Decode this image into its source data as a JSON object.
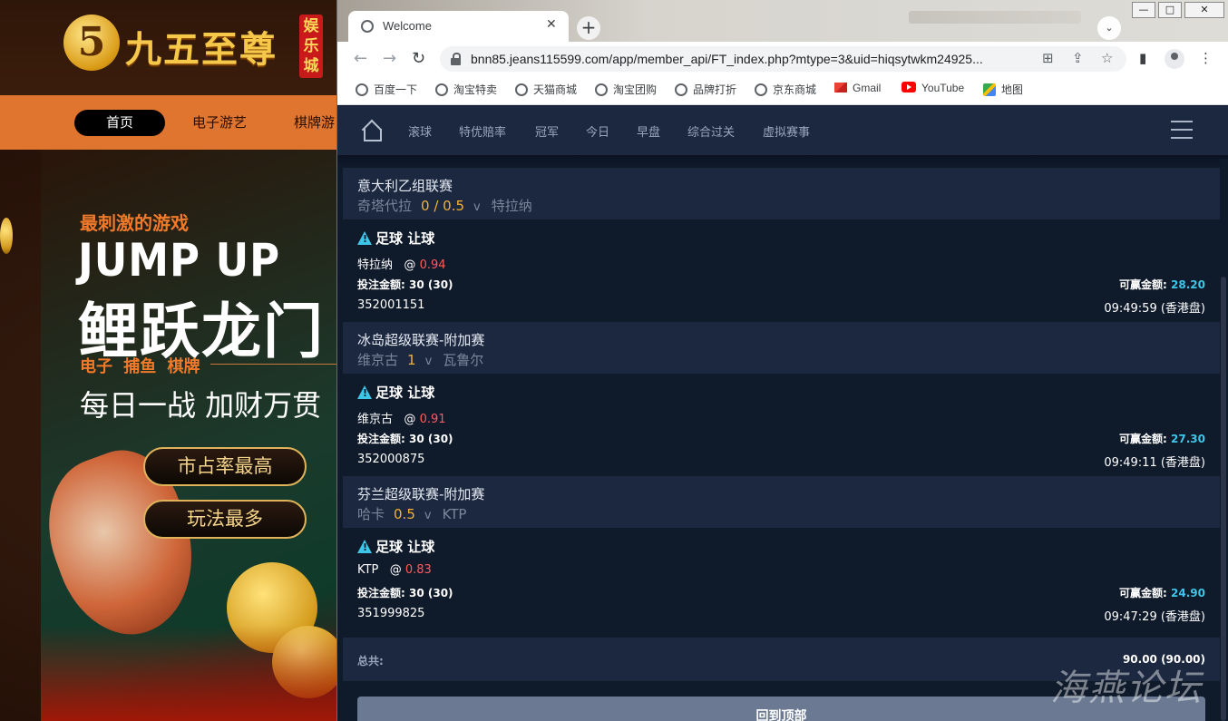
{
  "background_site": {
    "logo_text": "九五至尊",
    "logo_tag": "娱乐城",
    "nav": [
      "首页",
      "电子游艺",
      "棋牌游"
    ],
    "banner_tag": "最刺激的游戏",
    "banner_title_en": "JUMP UP",
    "banner_title_cn": "鲤跃龙门",
    "banner_sub": "电子 捕鱼 棋牌",
    "banner_daily": "每日一战 加财万贯",
    "pill_1": "市占率最高",
    "pill_2": "玩法最多"
  },
  "browser": {
    "tab_title": "Welcome",
    "url": "bnn85.jeans115599.com/app/member_api/FT_index.php?mtype=3&uid=hiqsytwkm24925...",
    "window_buttons": [
      "—",
      "□",
      "✕"
    ],
    "bookmarks": [
      {
        "label": "百度一下",
        "icon": "globe-icon"
      },
      {
        "label": "淘宝特卖",
        "icon": "globe-icon"
      },
      {
        "label": "天猫商城",
        "icon": "globe-icon"
      },
      {
        "label": "淘宝团购",
        "icon": "globe-icon"
      },
      {
        "label": "品牌打折",
        "icon": "globe-icon"
      },
      {
        "label": "京东商城",
        "icon": "globe-icon"
      },
      {
        "label": "Gmail",
        "icon": "gmail-icon"
      },
      {
        "label": "YouTube",
        "icon": "youtube-icon"
      },
      {
        "label": "地图",
        "icon": "maps-icon"
      }
    ]
  },
  "app": {
    "nav": [
      "滚球",
      "特优赔率",
      "冠军",
      "今日",
      "早盘",
      "综合过关",
      "虚拟赛事"
    ],
    "matches": [
      {
        "league": "意大利乙组联赛",
        "home": "奇塔代拉",
        "handicap": "0 / 0.5",
        "vs": "v",
        "away": "特拉纳",
        "bet_type": "足球 让球",
        "pick": "特拉纳",
        "odds_prefix": "@",
        "odds": "0.94",
        "stake_label": "投注金额:",
        "stake": "30 (30)",
        "win_label": "可赢金额:",
        "win": "28.20",
        "id": "352001151",
        "time": "09:49:59 (香港盘)"
      },
      {
        "league": "冰岛超级联赛-附加赛",
        "home": "维京古",
        "handicap": "1",
        "vs": "v",
        "away": "瓦鲁尔",
        "bet_type": "足球 让球",
        "pick": "维京古",
        "odds_prefix": "@",
        "odds": "0.91",
        "stake_label": "投注金额:",
        "stake": "30 (30)",
        "win_label": "可赢金额:",
        "win": "27.30",
        "id": "352000875",
        "time": "09:49:11 (香港盘)"
      },
      {
        "league": "芬兰超级联赛-附加赛",
        "home": "哈卡",
        "handicap": "0.5",
        "vs": "v",
        "away": "KTP",
        "bet_type": "足球 让球",
        "pick": "KTP",
        "odds_prefix": "@",
        "odds": "0.83",
        "stake_label": "投注金额:",
        "stake": "30 (30)",
        "win_label": "可赢金额:",
        "win": "24.90",
        "id": "351999825",
        "time": "09:47:29 (香港盘)"
      }
    ],
    "total_label": "总共:",
    "total_value": "90.00 (90.00)",
    "back_to_top": "回到顶部"
  },
  "watermark": "海燕论坛",
  "colors": {
    "page_bg": "#0f1a2b",
    "panel_bg": "#1c2840",
    "handicap": "#f2b233",
    "odds": "#ff5b5b",
    "win_amount": "#3ec6e8",
    "site_orange": "#e0752f"
  }
}
